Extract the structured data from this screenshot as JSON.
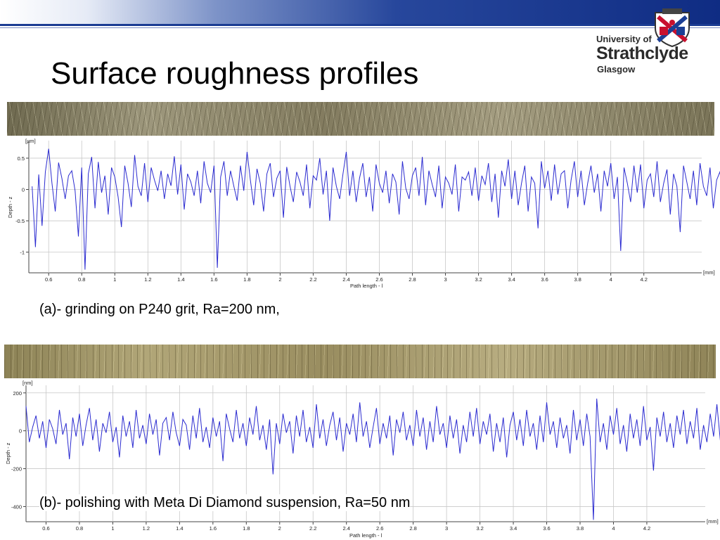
{
  "slide": {
    "title": "Surface roughness profiles",
    "caption_a": "(a)- grinding on P240 grit, Ra=200 nm,",
    "caption_b": "(b)- polishing with Meta Di Diamond suspension, Ra=50 nm"
  },
  "logo": {
    "line1": "University of",
    "line2": "Strathclyde",
    "line3": "Glasgow",
    "icon": "university-crest-icon"
  },
  "colors": {
    "header_blue": "#1b3c93",
    "profile_line": "#2b2bd0",
    "grid": "#c8c8c8"
  },
  "chart_data": [
    {
      "type": "line",
      "ylabel": "Depth - z",
      "yunit": "[µm]",
      "xlabel": "Path length - l",
      "xunit": "[mm]",
      "xlim": [
        0.48,
        4.55
      ],
      "ylim": [
        -1.33,
        0.78
      ],
      "xticks": [
        0.6,
        0.8,
        1,
        1.2,
        1.4,
        1.6,
        1.8,
        2,
        2.2,
        2.4,
        2.6,
        2.8,
        3,
        3.2,
        3.4,
        3.6,
        3.8,
        4,
        4.2
      ],
      "yticks": [
        0.5,
        0,
        -0.5,
        -1
      ],
      "grid": true,
      "series": [
        {
          "x_start": 0.5,
          "x_step": 0.02,
          "values": [
            0.05,
            -0.92,
            0.24,
            -0.58,
            0.28,
            0.65,
            0.1,
            -0.35,
            0.43,
            0.18,
            -0.15,
            0.22,
            0.3,
            -0.02,
            -0.75,
            0.35,
            -1.28,
            0.25,
            0.52,
            -0.3,
            0.44,
            -0.05,
            0.22,
            -0.4,
            0.35,
            0.2,
            -0.12,
            -0.6,
            0.38,
            0.1,
            -0.28,
            0.55,
            0.05,
            -0.1,
            0.42,
            -0.2,
            0.35,
            0.15,
            -0.02,
            0.3,
            -0.15,
            0.25,
            0.06,
            0.53,
            -0.08,
            0.4,
            -0.32,
            0.25,
            0.12,
            -0.1,
            0.3,
            -0.22,
            0.45,
            0.1,
            -0.05,
            0.38,
            -1.25,
            0.2,
            0.45,
            -0.1,
            0.3,
            0.05,
            -0.18,
            0.38,
            -0.02,
            0.6,
            0.15,
            -0.25,
            0.33,
            0.1,
            -0.35,
            0.25,
            0.42,
            -0.12,
            0.18,
            0.3,
            -0.45,
            0.36,
            0.05,
            -0.2,
            0.28,
            0.12,
            -0.1,
            0.4,
            -0.3,
            0.22,
            0.15,
            0.5,
            -0.08,
            0.3,
            -0.5,
            0.35,
            0.05,
            -0.15,
            0.25,
            0.6,
            -0.1,
            0.3,
            -0.2,
            0.18,
            0.42,
            -0.12,
            0.2,
            -0.35,
            0.4,
            0.1,
            -0.05,
            0.3,
            -0.22,
            0.25,
            0.12,
            -0.4,
            0.45,
            0.02,
            -0.15,
            0.22,
            0.35,
            -0.1,
            0.52,
            -0.25,
            0.3,
            0.08,
            -0.12,
            0.38,
            -0.3,
            0.2,
            0.1,
            -0.08,
            0.4,
            -0.35,
            0.2,
            0.15,
            0.28,
            -0.1,
            0.35,
            -0.18,
            0.22,
            0.08,
            0.42,
            -0.2,
            0.25,
            -0.45,
            0.3,
            0.05,
            0.48,
            -0.15,
            0.3,
            -0.25,
            0.1,
            0.38,
            -0.35,
            0.2,
            0.1,
            -0.62,
            0.45,
            0.02,
            0.3,
            -0.18,
            0.4,
            -0.08,
            0.25,
            0.3,
            -0.3,
            0.15,
            0.45,
            -0.12,
            0.3,
            -0.25,
            0.1,
            0.38,
            -0.05,
            0.25,
            -0.35,
            0.3,
            0.05,
            0.42,
            -0.15,
            0.2,
            -0.98,
            0.35,
            0.1,
            -0.2,
            0.38,
            -0.05,
            0.4,
            -0.3,
            0.15,
            0.25,
            -0.12,
            0.45,
            -0.2,
            0.1,
            0.32,
            -0.4,
            0.25,
            0.05,
            -0.68,
            0.38,
            0.12,
            -0.15,
            0.3,
            -0.25,
            0.42,
            0.05,
            -0.1,
            0.35,
            -0.3,
            0.15,
            0.28,
            -0.05,
            0.12,
            -0.35
          ]
        }
      ]
    },
    {
      "type": "line",
      "ylabel": "Depth - z",
      "yunit": "[nm]",
      "xlabel": "Path length - l",
      "xunit": "[mm]",
      "xlim": [
        0.48,
        4.55
      ],
      "ylim": [
        -480,
        240
      ],
      "xticks": [
        0.6,
        0.8,
        1,
        1.2,
        1.4,
        1.6,
        1.8,
        2,
        2.2,
        2.4,
        2.6,
        2.8,
        3,
        3.2,
        3.4,
        3.6,
        3.8,
        4,
        4.2
      ],
      "yticks": [
        200,
        0,
        -200,
        -400
      ],
      "grid": true,
      "series": [
        {
          "x_start": 0.48,
          "x_step": 0.02,
          "values": [
            130,
            -60,
            20,
            80,
            -40,
            50,
            -90,
            60,
            10,
            -70,
            110,
            -20,
            40,
            -150,
            70,
            -30,
            90,
            -80,
            30,
            120,
            -50,
            60,
            -110,
            40,
            -10,
            100,
            -60,
            20,
            -140,
            80,
            -30,
            50,
            -90,
            110,
            -40,
            30,
            -70,
            90,
            -20,
            60,
            -130,
            40,
            70,
            -50,
            100,
            -10,
            -80,
            60,
            30,
            -100,
            80,
            -40,
            120,
            -60,
            20,
            -90,
            70,
            -30,
            50,
            -160,
            90,
            10,
            -60,
            110,
            -40,
            40,
            -80,
            70,
            -20,
            130,
            -50,
            30,
            -100,
            60,
            -230,
            40,
            -70,
            90,
            -10,
            50,
            -120,
            80,
            -30,
            110,
            -60,
            20,
            -90,
            140,
            -40,
            60,
            -80,
            30,
            100,
            -50,
            70,
            -110,
            40,
            -20,
            90,
            -60,
            150,
            -30,
            50,
            -90,
            20,
            120,
            -70,
            40,
            -40,
            80,
            -130,
            60,
            -10,
            100,
            -50,
            30,
            -80,
            110,
            -30,
            70,
            -100,
            50,
            -60,
            130,
            -20,
            40,
            -90,
            80,
            -40,
            60,
            -120,
            30,
            -60,
            100,
            -30,
            120,
            -70,
            50,
            -20,
            90,
            -110,
            40,
            -60,
            70,
            -140,
            30,
            100,
            -50,
            60,
            -80,
            110,
            -30,
            40,
            -100,
            80,
            -60,
            150,
            -20,
            50,
            -90,
            70,
            -40,
            30,
            -120,
            110,
            -50,
            60,
            -80,
            90,
            -30,
            -470,
            170,
            -60,
            40,
            -100,
            80,
            -20,
            120,
            -70,
            30,
            -110,
            90,
            -40,
            60,
            -80,
            130,
            -50,
            20,
            -210,
            70,
            -30,
            100,
            -60,
            40,
            -90,
            80,
            -20,
            110,
            -70,
            50,
            -40,
            120,
            -100,
            30,
            -60,
            90,
            -30,
            140,
            -50,
            40,
            -80,
            70,
            -20,
            130,
            -110,
            60,
            -40,
            100,
            -70,
            30,
            -190,
            80,
            -30,
            120,
            -60,
            40,
            -90,
            110,
            -40,
            70,
            -120,
            30,
            -60,
            90
          ]
        }
      ]
    }
  ]
}
